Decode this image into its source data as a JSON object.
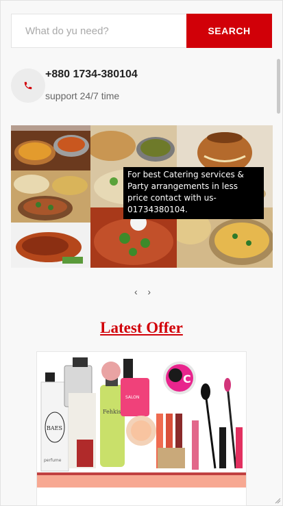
{
  "search": {
    "placeholder": "What do yu need?",
    "button_label": "SEARCH"
  },
  "support": {
    "phone": "+880 1734-380104",
    "text": "support 24/7 time",
    "icon": "phone-icon"
  },
  "slider": {
    "caption": "For best Catering services & Party arrangements in less price contact with us- 01734380104.",
    "prev": "‹",
    "next": "›"
  },
  "offer": {
    "title": "Latest Offer",
    "logo_text": "C",
    "products": [
      {
        "label": "BAES"
      },
      {
        "label": "Fehkis"
      },
      {
        "label": "SALON"
      },
      {
        "label": "perfume"
      }
    ]
  },
  "colors": {
    "accent": "#d10008",
    "background": "#f8f8f8",
    "caption_bg": "#000000"
  }
}
